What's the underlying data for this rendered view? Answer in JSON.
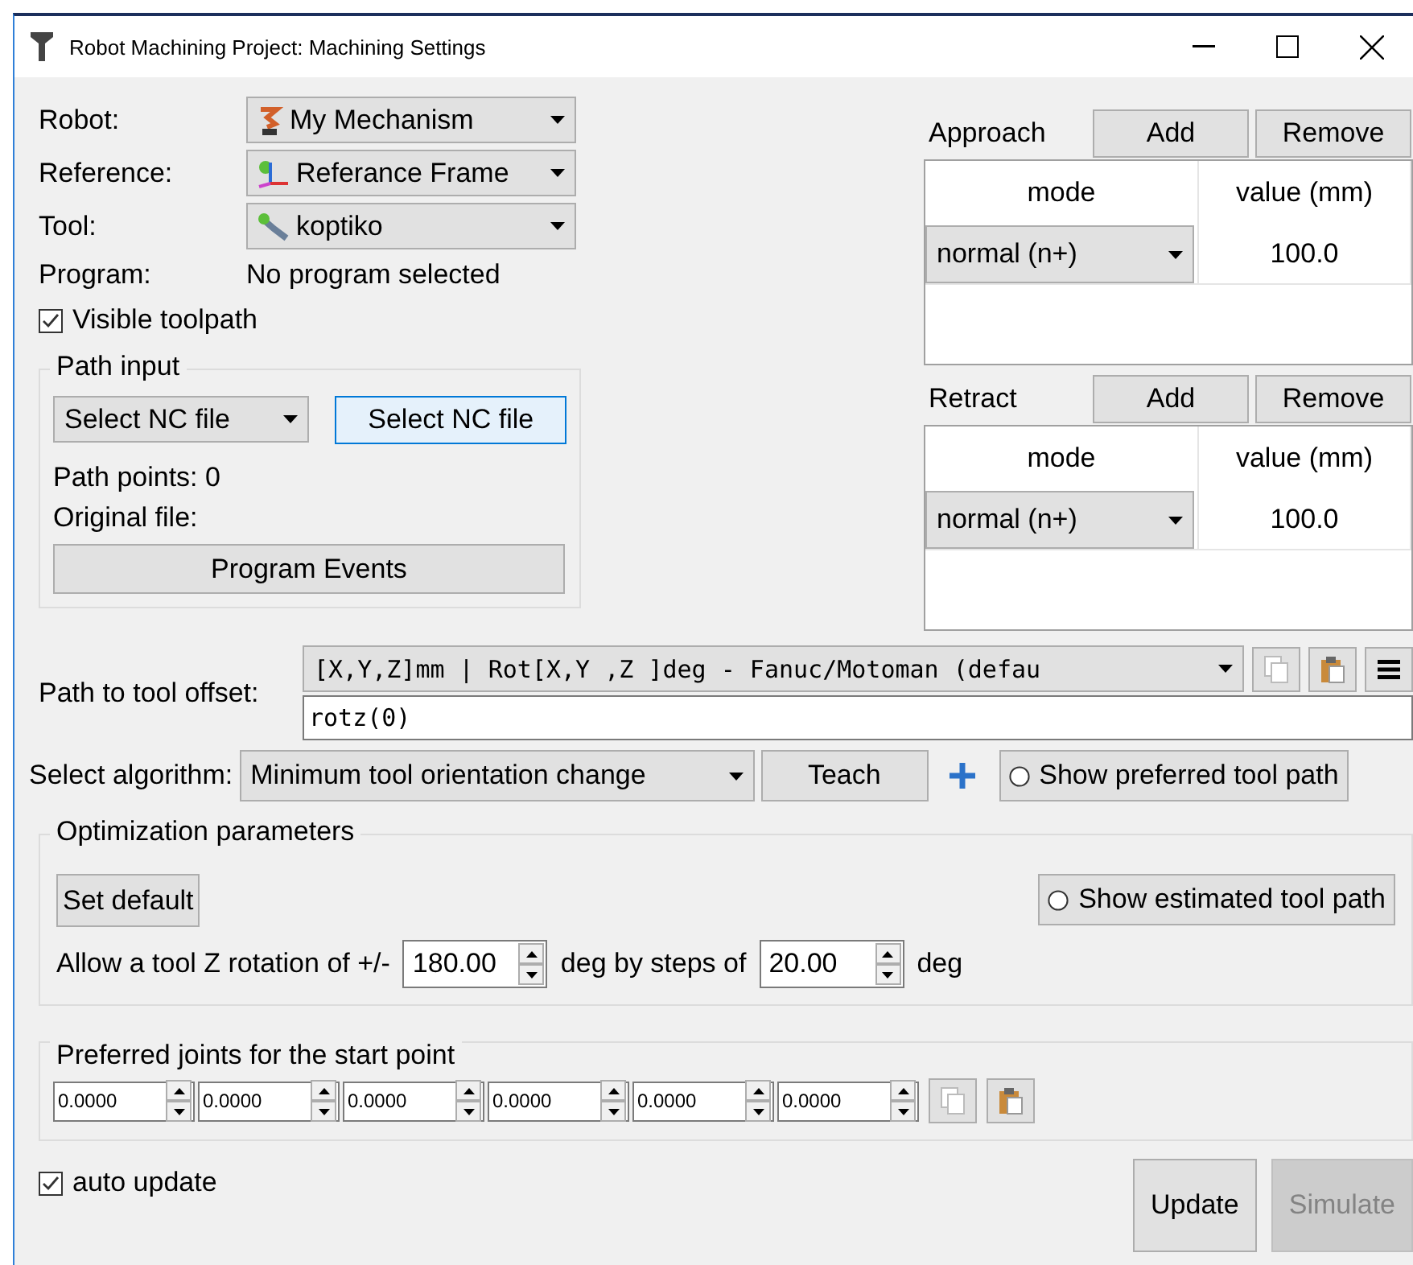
{
  "window": {
    "title": "Robot Machining Project: Machining Settings"
  },
  "selectors": [
    {
      "kind": "robot",
      "label": "Robot:",
      "value": "My Mechanism"
    },
    {
      "kind": "frame",
      "label": "Reference:",
      "value": "Referance Frame"
    },
    {
      "kind": "tool",
      "label": "Tool:",
      "value": "koptiko"
    }
  ],
  "program": {
    "label": "Program:",
    "value": "No program selected"
  },
  "visible_toolpath": {
    "label": "Visible toolpath",
    "checked": true
  },
  "path_input": {
    "title": "Path input",
    "source": "Select NC file",
    "button": "Select NC file",
    "path_points": "Path points: 0",
    "original_file": "Original file:",
    "events_button": "Program Events"
  },
  "moves": [
    {
      "title": "Approach",
      "add": "Add",
      "remove": "Remove",
      "columns": [
        "mode",
        "value (mm)"
      ],
      "rows": [
        {
          "mode": "normal (n+)",
          "value": "100.0"
        }
      ]
    },
    {
      "title": "Retract",
      "add": "Add",
      "remove": "Remove",
      "columns": [
        "mode",
        "value (mm)"
      ],
      "rows": [
        {
          "mode": "normal (n+)",
          "value": "100.0"
        }
      ]
    }
  ],
  "tool_offset": {
    "label": "Path to tool offset:",
    "format": "[X,Y,Z]mm | Rot[X,Y ,Z  ]deg - Fanuc/Motoman (defau",
    "value": "rotz(0)"
  },
  "algorithm": {
    "label": "Select algorithm:",
    "value": "Minimum tool orientation change",
    "teach": "Teach",
    "show_preferred": {
      "label": "Show preferred tool path",
      "selected": false
    }
  },
  "optimization": {
    "title": "Optimization parameters",
    "set_default": "Set default",
    "show_estimated": {
      "label": "Show estimated tool path",
      "selected": false
    },
    "rotation_label": "Allow a tool Z rotation of +/-",
    "rotation": "180.00",
    "steps_label": "deg by steps of",
    "step": "20.00",
    "unit": "deg"
  },
  "preferred_joints": {
    "title": "Preferred joints for the start point",
    "joints": [
      "0.0000",
      "0.0000",
      "0.0000",
      "0.0000",
      "0.0000",
      "0.0000"
    ]
  },
  "auto_update": {
    "label": "auto update",
    "checked": true
  },
  "buttons": [
    {
      "label": "Update",
      "disabled": false
    },
    {
      "label": "Simulate",
      "disabled": true
    }
  ]
}
